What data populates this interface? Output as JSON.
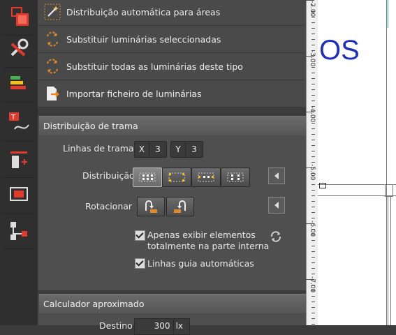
{
  "toolbar": {
    "buttons": [
      {
        "name": "layout-tool-icon"
      },
      {
        "name": "tools-icon"
      },
      {
        "name": "energy-class-icon"
      },
      {
        "name": "text-curve-icon"
      },
      {
        "name": "insert-element-icon"
      },
      {
        "name": "frame-select-icon"
      },
      {
        "name": "tree-structure-icon"
      }
    ],
    "accent": "#e23a2c"
  },
  "menu": {
    "items": [
      {
        "label": "Distribuição automática para áreas",
        "icon": "magic-wand-icon"
      },
      {
        "label": "Substituir luminárias seleccionadas",
        "icon": "replace-selected-icon"
      },
      {
        "label": "Substituir todas as luminárias deste tipo",
        "icon": "replace-all-icon"
      },
      {
        "label": "Importar ficheiro de luminárias",
        "icon": "import-file-icon"
      }
    ]
  },
  "grid_section": {
    "title": "Distribuição de trama",
    "grid_lines_label": "Linhas de trama",
    "x_axis": {
      "label": "X",
      "value": "3"
    },
    "y_axis": {
      "label": "Y",
      "value": "3"
    },
    "distribution_label": "Distribuição",
    "rotate_label": "Rotacionar",
    "checkbox_inner": {
      "label_line1": "Apenas exibir elementos",
      "label_line2": "totalmente na parte interna",
      "checked": true
    },
    "checkbox_guides": {
      "label": "Linhas guia automáticas",
      "checked": true
    }
  },
  "calc_section": {
    "title": "Calculador aproximado",
    "target_label": "Destino",
    "target_value": "300",
    "target_unit": "lx"
  },
  "canvas": {
    "label": "OS",
    "label_color": "#1f2fb8",
    "ruler_ticks": [
      "-2.00",
      "-3.00",
      "-4.00",
      "-5.00",
      "-6.00",
      "-7.00"
    ]
  }
}
